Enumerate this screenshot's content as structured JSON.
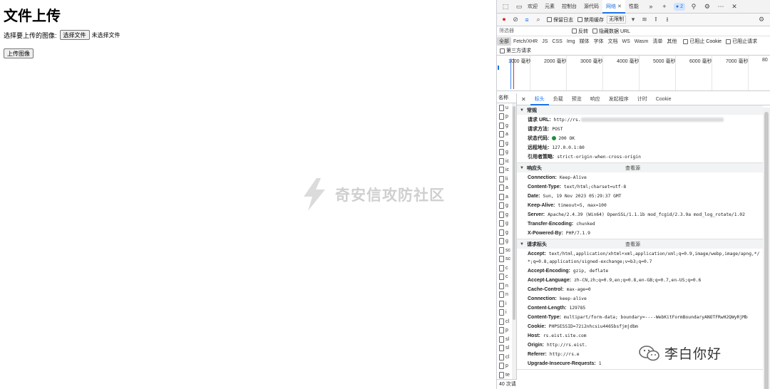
{
  "page": {
    "title": "文件上传",
    "select_label": "选择要上传的图像:",
    "choose_file": "选择文件",
    "no_file": "未选择文件",
    "upload_button": "上传图像"
  },
  "watermark": {
    "text": "奇安信攻防社区"
  },
  "devtools": {
    "tabs": [
      "欢迎",
      "元素",
      "控制台",
      "源代码",
      "网络",
      "性能"
    ],
    "active_tab": "网络",
    "issues_count": "2",
    "toolbar": {
      "preserve_log": "保留日志",
      "disable_cache": "禁用缓存",
      "throttle": "无限制"
    },
    "filter": {
      "placeholder": "筛选器",
      "invert": "反转",
      "hide_data_urls": "隐藏数据 URL"
    },
    "types": [
      "全部",
      "Fetch/XHR",
      "JS",
      "CSS",
      "Img",
      "媒体",
      "字体",
      "文档",
      "WS",
      "Wasm",
      "清单",
      "其他"
    ],
    "blocked_cookies": "已阻止 Cookie",
    "blocked_requests": "已阻止请求",
    "third_party": "第三方请求",
    "timeline_ticks": [
      "1000 毫秒",
      "2000 毫秒",
      "3000 毫秒",
      "4000 毫秒",
      "5000 毫秒",
      "6000 毫秒",
      "7000 毫秒",
      "80"
    ],
    "list": {
      "header": "名称",
      "items": [
        "u",
        "p",
        "g",
        "a",
        "g",
        "g",
        "ic",
        "ic",
        "li",
        "a",
        "a",
        "g",
        "g",
        "g",
        "g",
        "g",
        "sc",
        "sc",
        "c",
        "c",
        "n",
        "n",
        "i",
        "i",
        "cl",
        "p",
        "sl",
        "sl",
        "cl",
        "p",
        "te",
        "c"
      ],
      "footer": "40 次请"
    },
    "detail_tabs": [
      "标头",
      "负载",
      "预览",
      "响应",
      "发起程序",
      "计时",
      "Cookie"
    ],
    "general": {
      "title": "常规",
      "rows": [
        {
          "k": "请求 URL:",
          "v": "http://rs."
        },
        {
          "k": "请求方法:",
          "v": "POST"
        },
        {
          "k": "状态代码:",
          "v": "200 OK"
        },
        {
          "k": "远程地址:",
          "v": "127.0.0.1:80"
        },
        {
          "k": "引用者策略:",
          "v": "strict-origin-when-cross-origin"
        }
      ]
    },
    "response_headers": {
      "title": "响应头",
      "view_source": "查看源",
      "rows": [
        {
          "k": "Connection:",
          "v": "Keep-Alive"
        },
        {
          "k": "Content-Type:",
          "v": "text/html;charset=utf-8"
        },
        {
          "k": "Date:",
          "v": "Sun, 19 Nov 2023 05:29:37 GMT"
        },
        {
          "k": "Keep-Alive:",
          "v": "timeout=5, max=100"
        },
        {
          "k": "Server:",
          "v": "Apache/2.4.39 (Win64) OpenSSL/1.1.1b mod_fcgid/2.3.9a mod_log_rotate/1.02"
        },
        {
          "k": "Transfer-Encoding:",
          "v": "chunked"
        },
        {
          "k": "X-Powered-By:",
          "v": "PHP/7.1.9"
        }
      ]
    },
    "request_headers": {
      "title": "请求标头",
      "view_source": "查看源",
      "rows": [
        {
          "k": "Accept:",
          "v": "text/html,application/xhtml+xml,application/xml;q=0.9,image/webp,image/apng,*/*;q=0.8,application/signed-exchange;v=b3;q=0.7"
        },
        {
          "k": "Accept-Encoding:",
          "v": "gzip, deflate"
        },
        {
          "k": "Accept-Language:",
          "v": "zh-CN,zh;q=0.9,en;q=0.8,en-GB;q=0.7,en-US;q=0.6"
        },
        {
          "k": "Cache-Control:",
          "v": "max-age=0"
        },
        {
          "k": "Connection:",
          "v": "keep-alive"
        },
        {
          "k": "Content-Length:",
          "v": "129785"
        },
        {
          "k": "Content-Type:",
          "v": "multipart/form-data; boundary=----WebKitFormBoundaryANOTFRwH2QWyRjMb"
        },
        {
          "k": "Cookie:",
          "v": "PHPSESSID=72i2nhcsiu4465bsfjmjdbm"
        },
        {
          "k": "Host:",
          "v": "rs.eist.site.com"
        },
        {
          "k": "Origin:",
          "v": "http://rs.eist."
        },
        {
          "k": "Referer:",
          "v": "http://rs.e"
        },
        {
          "k": "Upgrade-Insecure-Requests:",
          "v": "1"
        }
      ]
    }
  },
  "overlay": {
    "wechat_name": "李白你好"
  }
}
